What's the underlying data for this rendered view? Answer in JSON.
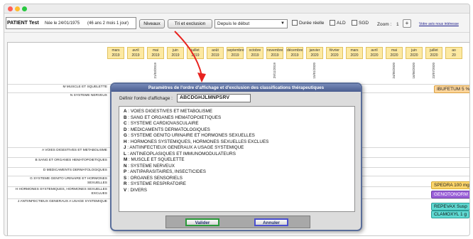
{
  "toolbar": {
    "patient_name": "PATIENT Test",
    "patient_info": "Née le 24/01/1975",
    "patient_age": "(46 ans 2 mois 1 jour)",
    "niveaux_label": "Niveaux",
    "tri_label": "Tri et exclusion",
    "period_value": "Depuis le début",
    "duree_label": "Durée réelle",
    "ald_label": "ALD",
    "sgd_label": "SGD",
    "zoom_label": "Zoom :",
    "zoom_value": "1",
    "plus_label": "+",
    "help_label": "Votre avis nous intéresse"
  },
  "months": [
    {
      "m": "mars",
      "y": "2019"
    },
    {
      "m": "avril",
      "y": "2019"
    },
    {
      "m": "mai",
      "y": "2019"
    },
    {
      "m": "juin",
      "y": "2019"
    },
    {
      "m": "juillet",
      "y": "2019"
    },
    {
      "m": "août",
      "y": "2019"
    },
    {
      "m": "septembre",
      "y": "2019"
    },
    {
      "m": "octobre",
      "y": "2019"
    },
    {
      "m": "novembre",
      "y": "2019"
    },
    {
      "m": "décembre",
      "y": "2019"
    },
    {
      "m": "janvier",
      "y": "2020"
    },
    {
      "m": "février",
      "y": "2020"
    },
    {
      "m": "mars",
      "y": "2020"
    },
    {
      "m": "avril",
      "y": "2020"
    },
    {
      "m": "mai",
      "y": "2020"
    },
    {
      "m": "juin",
      "y": "2020"
    },
    {
      "m": "juillet",
      "y": "2020"
    },
    {
      "m": "ao",
      "y": "20"
    }
  ],
  "visit_dates": [
    "21/03/2019",
    "29/11/2019",
    "15/01/2020",
    "24/05/2020",
    "16/06/2020",
    "23/07/2020"
  ],
  "row_labels": [
    "M MUSCLE ET SQUELETTE",
    "N SYSTEME NERVEUX",
    "A VOIES DIGESTIVES ET METABOLISME",
    "B SANG ET ORGANES HEMATOPOIETIQUES",
    "D MEDICAMENTS DERMATOLOGIQUES",
    "G SYSTEME GENITO URINAIRE ET HORMONES SEXUELLES",
    "H HORMONES SYSTEMIQUES, HORMONES SEXUELLES EXCLUES",
    "J ANTIINFECTIEUX GENERAUX A USAGE SYSTEMIQUE"
  ],
  "meds": [
    {
      "name": "IBUFETUM 5 %",
      "bg": "#fdd59a",
      "border": "#d9a040",
      "color": "#222"
    },
    {
      "name": "SPEDRA 100 mg",
      "bg": "#fdd66b",
      "border": "#d4a933",
      "color": "#222"
    },
    {
      "name": "GENOTONORM",
      "bg": "#9a5fd8",
      "border": "#6b3aa6",
      "color": "#ffffff"
    },
    {
      "name": "REPEVAX Susp",
      "bg": "#5fd9d2",
      "border": "#2a9c96",
      "color": "#111"
    },
    {
      "name": "CLAMOXYL 1 g",
      "bg": "#5fd9d2",
      "border": "#2a9c96",
      "color": "#111"
    }
  ],
  "dialog": {
    "title": "Paramètres de l'ordre d'affichage et d'exclusion des classifications thérapeutiques",
    "order_label": "Définir l'ordre d'affichage :",
    "order_value": "ABCDGHJLMNPSRV",
    "items": [
      {
        "code": "A",
        "label": "VOIES DIGESTIVES ET METABOLISME"
      },
      {
        "code": "B",
        "label": "SANG ET ORGANES HEMATOPOIETIQUES"
      },
      {
        "code": "C",
        "label": "SYSTEME CARDIOVASCULAIRE"
      },
      {
        "code": "D",
        "label": "MEDICAMENTS DERMATOLOGIQUES"
      },
      {
        "code": "G",
        "label": "SYSTEME GENITO URINAIRE ET HORMONES SEXUELLES"
      },
      {
        "code": "H",
        "label": "HORMONES SYSTEMIQUES, HORMONES SEXUELLES EXCLUES"
      },
      {
        "code": "J",
        "label": "ANTIINFECTIEUX GENERAUX A USAGE SYSTEMIQUE"
      },
      {
        "code": "L",
        "label": "ANTINEOPLASIQUES ET IMMUNOMODULATEURS"
      },
      {
        "code": "M",
        "label": "MUSCLE ET SQUELETTE"
      },
      {
        "code": "N",
        "label": "SYSTEME NERVEUX"
      },
      {
        "code": "P",
        "label": "ANTIPARASITAIRES, INSECTICIDES"
      },
      {
        "code": "S",
        "label": "ORGANES SENSORIELS"
      },
      {
        "code": "R",
        "label": "SYSTEME RESPIRATOIRE"
      },
      {
        "code": "V",
        "label": "DIVERS"
      }
    ],
    "ok_label": "Valider",
    "cancel_label": "Annuler"
  },
  "colors": {
    "month_bg": "#fde9a2",
    "dialog_title": "#4a5d8f",
    "arrow": "#e8231f"
  }
}
